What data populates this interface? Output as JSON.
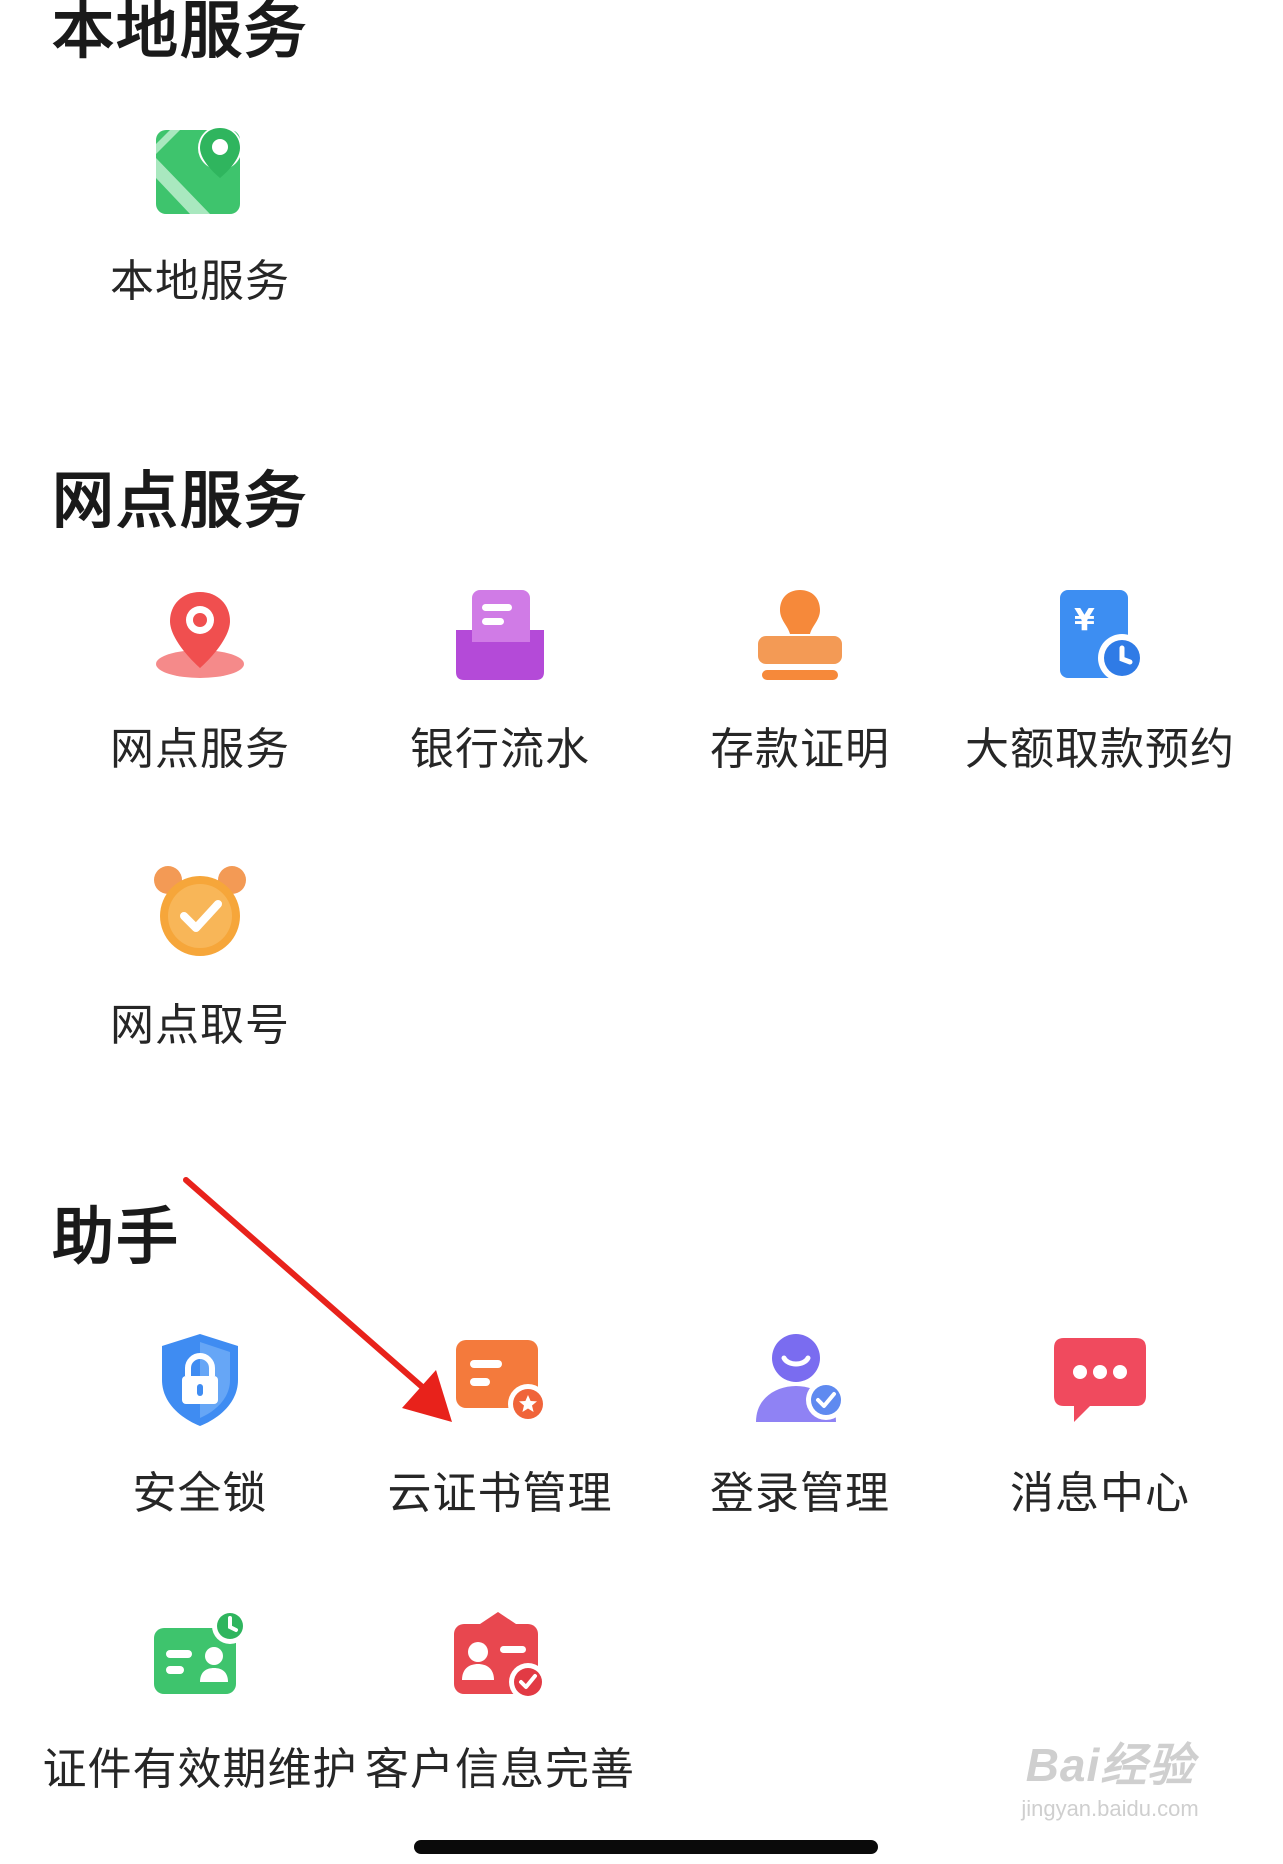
{
  "sections": {
    "local": {
      "title": "本地服务",
      "items": [
        {
          "label": "本地服务",
          "icon": "map-pin-icon",
          "color": "#3ec46d"
        }
      ]
    },
    "outlet": {
      "title": "网点服务",
      "items": [
        {
          "label": "网点服务",
          "icon": "location-pin-icon",
          "color": "#f25656"
        },
        {
          "label": "银行流水",
          "icon": "document-tray-icon",
          "color": "#c45fdc"
        },
        {
          "label": "存款证明",
          "icon": "stamp-icon",
          "color": "#f6893a"
        },
        {
          "label": "大额取款预约",
          "icon": "yuan-clock-icon",
          "color": "#3d8ef2"
        },
        {
          "label": "网点取号",
          "icon": "alarm-clock-check-icon",
          "color": "#f6a63a"
        }
      ]
    },
    "assistant": {
      "title": "助手",
      "items": [
        {
          "label": "安全锁",
          "icon": "shield-lock-icon",
          "color": "#3f8cf2"
        },
        {
          "label": "云证书管理",
          "icon": "certificate-card-icon",
          "color": "#f47a3c"
        },
        {
          "label": "登录管理",
          "icon": "user-check-icon",
          "color": "#7a6cf0"
        },
        {
          "label": "消息中心",
          "icon": "chat-bubble-icon",
          "color": "#f04a5e"
        },
        {
          "label": "证件有效期维护",
          "icon": "id-card-clock-icon",
          "color": "#3ec46d"
        },
        {
          "label": "客户信息完善",
          "icon": "profile-card-check-icon",
          "color": "#e8474f"
        }
      ]
    }
  },
  "annotation": {
    "color": "#e8221b"
  },
  "watermark": {
    "main": "Bai经验",
    "sub": "jingyan.baidu.com"
  }
}
